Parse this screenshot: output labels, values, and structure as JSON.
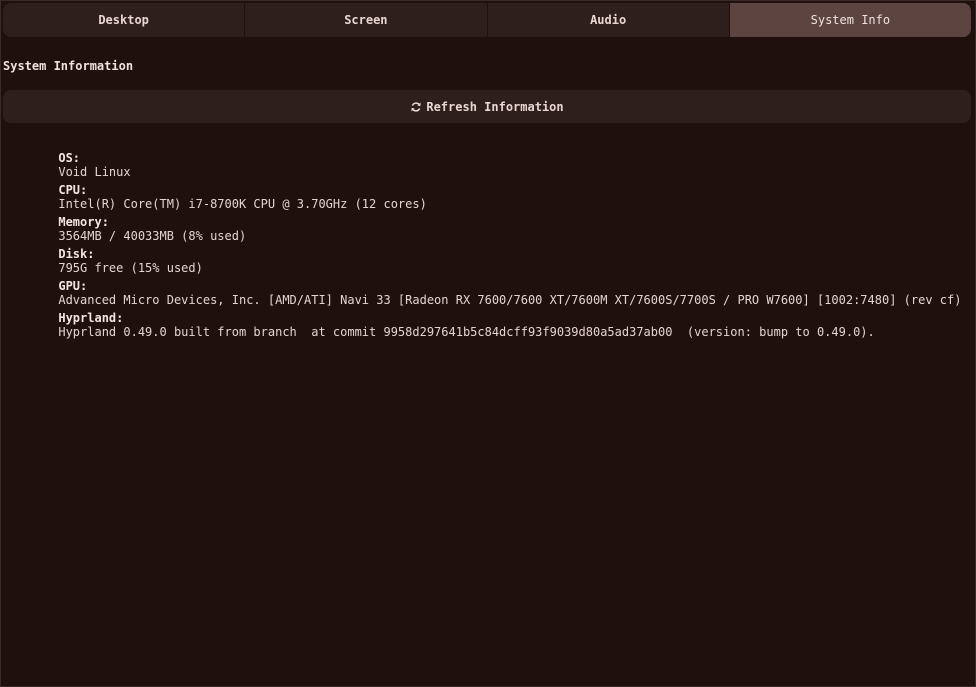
{
  "tabs": [
    {
      "label": "Desktop",
      "active": false
    },
    {
      "label": "Screen",
      "active": false
    },
    {
      "label": "Audio",
      "active": false
    },
    {
      "label": "System Info",
      "active": true
    }
  ],
  "section_title": "System Information",
  "refresh_button": {
    "label": "Refresh Information",
    "icon": "refresh-icon"
  },
  "info": {
    "os": {
      "key": "OS:",
      "value": "Void Linux"
    },
    "cpu": {
      "key": "CPU:",
      "value": "Intel(R) Core(TM) i7-8700K CPU @ 3.70GHz (12 cores)"
    },
    "memory": {
      "key": "Memory:",
      "value": "3564MB / 40033MB (8% used)"
    },
    "disk": {
      "key": "Disk:",
      "value": "795G free (15% used)"
    },
    "gpu": {
      "key": "GPU:",
      "value": "Advanced Micro Devices, Inc. [AMD/ATI] Navi 33 [Radeon RX 7600/7600 XT/7600M XT/7600S/7700S / PRO W7600] [1002:7480] (rev cf)"
    },
    "hyprland": {
      "key": "Hyprland:",
      "value": "Hyprland 0.49.0 built from branch  at commit 9958d297641b5c84dcff93f9039d80a5ad37ab00  (version: bump to 0.49.0)."
    }
  },
  "colors": {
    "background": "#1f100e",
    "panel": "#2f1f1c",
    "active_tab": "#5c4440",
    "text": "#e8d6d2"
  }
}
